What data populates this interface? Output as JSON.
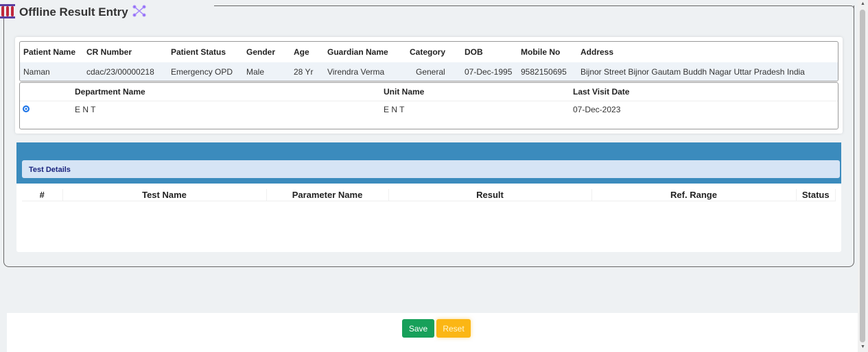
{
  "header": {
    "title": "Offline Result Entry",
    "logo_icon": "test-tubes-icon",
    "expand_icon": "expand-arrows-icon"
  },
  "patient": {
    "headers": [
      "Patient Name",
      "CR Number",
      "Patient Status",
      "Gender",
      "Age",
      "Guardian Name",
      "Category",
      "DOB",
      "Mobile No",
      "Address"
    ],
    "values": [
      "Naman",
      "cdac/23/00000218",
      "Emergency OPD",
      "Male",
      "28 Yr",
      "Virendra Verma",
      "General",
      "07-Dec-1995",
      "9582150695",
      "Bijnor Street Bijnor Gautam Buddh Nagar Uttar Pradesh India"
    ]
  },
  "visit": {
    "headers": [
      "Department Name",
      "Unit Name",
      "Last Visit Date"
    ],
    "row": {
      "selected": true,
      "department": "E N T",
      "unit": "E N T",
      "last_visit": "07-Dec-2023"
    }
  },
  "test_details": {
    "title": "Test Details",
    "headers": [
      "#",
      "Test Name",
      "Parameter Name",
      "Result",
      "Ref. Range",
      "Status"
    ],
    "rows": []
  },
  "actions": {
    "save": "Save",
    "reset": "Reset"
  },
  "colors": {
    "save": "#17a05a",
    "reset": "#fbb614",
    "band": "#3b8bbd"
  }
}
